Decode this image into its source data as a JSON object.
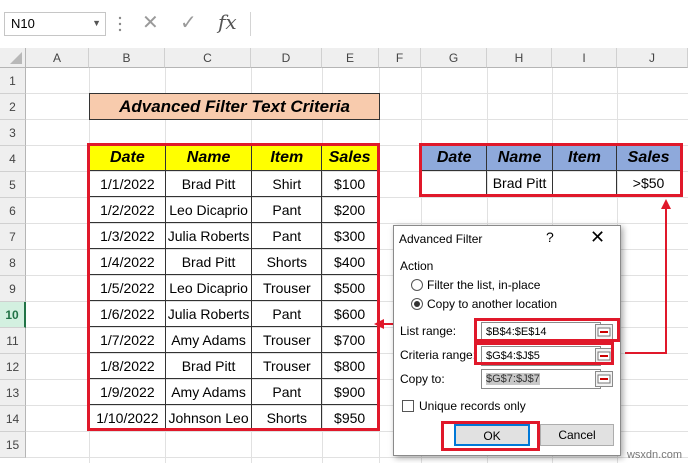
{
  "formula_bar": {
    "name_box": "N10",
    "fx_label": "fx",
    "cancel_glyph": "✕",
    "enter_glyph": "✓"
  },
  "columns": [
    "A",
    "B",
    "C",
    "D",
    "E",
    "F",
    "G",
    "H",
    "I",
    "J"
  ],
  "rows": [
    "1",
    "2",
    "3",
    "4",
    "5",
    "6",
    "7",
    "8",
    "9",
    "10",
    "11",
    "12",
    "13",
    "14",
    "15"
  ],
  "selected_row": "10",
  "title": "Advanced Filter Text Criteria",
  "main_table": {
    "headers": [
      "Date",
      "Name",
      "Item",
      "Sales"
    ],
    "rows": [
      [
        "1/1/2022",
        "Brad Pitt",
        "Shirt",
        "$100"
      ],
      [
        "1/2/2022",
        "Leo Dicaprio",
        "Pant",
        "$200"
      ],
      [
        "1/3/2022",
        "Julia Roberts",
        "Pant",
        "$300"
      ],
      [
        "1/4/2022",
        "Brad Pitt",
        "Shorts",
        "$400"
      ],
      [
        "1/5/2022",
        "Leo Dicaprio",
        "Trouser",
        "$500"
      ],
      [
        "1/6/2022",
        "Julia Roberts",
        "Pant",
        "$600"
      ],
      [
        "1/7/2022",
        "Amy Adams",
        "Trouser",
        "$700"
      ],
      [
        "1/8/2022",
        "Brad Pitt",
        "Trouser",
        "$800"
      ],
      [
        "1/9/2022",
        "Amy Adams",
        "Pant",
        "$900"
      ],
      [
        "1/10/2022",
        "Johnson Leo",
        "Shorts",
        "$950"
      ]
    ]
  },
  "criteria_table": {
    "headers": [
      "Date",
      "Name",
      "Item",
      "Sales"
    ],
    "row": [
      "",
      "Brad Pitt",
      "",
      ">$50"
    ]
  },
  "dialog": {
    "title": "Advanced Filter",
    "help": "?",
    "close": "✕",
    "action_label": "Action",
    "option_filter": "Filter the list, in-place",
    "option_copy": "Copy to another location",
    "list_range_label": "List range:",
    "list_range_value": "$B$4:$E$14",
    "criteria_range_label": "Criteria range:",
    "criteria_range_value": "$G$4:$J$5",
    "copy_to_label": "Copy to:",
    "copy_to_value": "$G$7:$J$7",
    "unique_label": "Unique records only",
    "ok": "OK",
    "cancel": "Cancel"
  },
  "colors": {
    "red": "#e0182a",
    "main_header": "#ffff00",
    "criteria_header": "#8ea9db",
    "title_bg": "#f8cbad"
  },
  "watermark": "wsxdn.com"
}
